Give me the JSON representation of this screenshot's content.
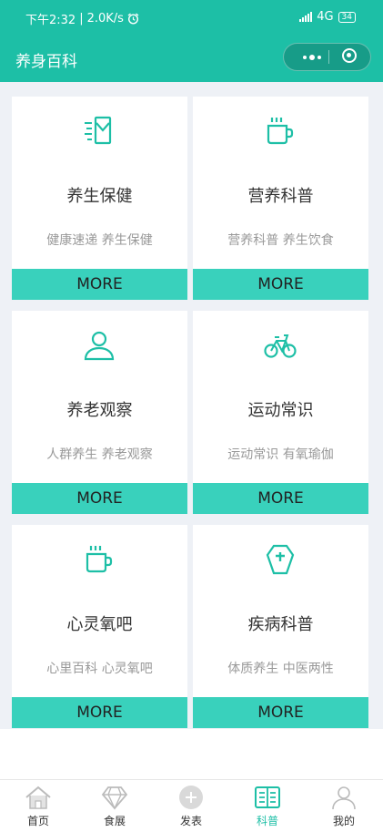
{
  "status_bar": {
    "time": "下午2:32",
    "separator": "|",
    "speed": "2.0K/s",
    "network": "4G",
    "battery": "34"
  },
  "nav": {
    "title": "养身百科"
  },
  "cards": [
    {
      "title": "养生保健",
      "subtitle": "健康速递 养生保健",
      "more": "MORE",
      "icon": "phone-message-icon"
    },
    {
      "title": "营养科普",
      "subtitle": "营养科普 养生饮食",
      "more": "MORE",
      "icon": "coffee-cup-icon"
    },
    {
      "title": "养老观察",
      "subtitle": "人群养生 养老观察",
      "more": "MORE",
      "icon": "person-icon"
    },
    {
      "title": "运动常识",
      "subtitle": "运动常识 有氧瑜伽",
      "more": "MORE",
      "icon": "bicycle-icon"
    },
    {
      "title": "心灵氧吧",
      "subtitle": "心里百科 心灵氧吧",
      "more": "MORE",
      "icon": "coffee-cup-icon"
    },
    {
      "title": "疾病科普",
      "subtitle": "体质养生 中医两性",
      "more": "MORE",
      "icon": "medical-shield-icon"
    }
  ],
  "tabs": [
    {
      "label": "首页",
      "icon": "home-icon"
    },
    {
      "label": "食展",
      "icon": "diamond-icon"
    },
    {
      "label": "发表",
      "icon": "plus-circle-icon"
    },
    {
      "label": "科普",
      "icon": "book-icon",
      "active": true
    },
    {
      "label": "我的",
      "icon": "user-icon"
    }
  ],
  "colors": {
    "primary": "#1dbfa6",
    "more_bg": "#39d1bc",
    "page_bg": "#eef1f6"
  }
}
